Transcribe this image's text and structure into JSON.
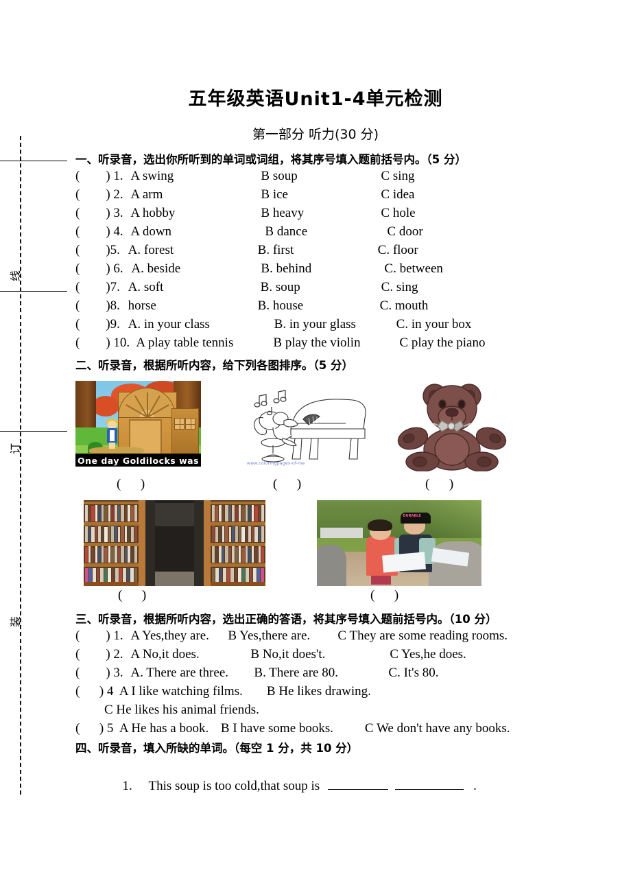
{
  "document": {
    "title": "五年级英语Unit1-4单元检测",
    "part_title": "第一部分    听力(30 分)"
  },
  "binding_margin": {
    "chars": [
      "线",
      "订",
      "装"
    ]
  },
  "sections": [
    {
      "id": "section-1",
      "heading": "一、听录音，选出你所听到的单词或词组，将其序号填入题前括号内。（5 分）",
      "questions": [
        {
          "paren": "(        ) ",
          "num": "1.",
          "a": "A swing",
          "b": "B soup",
          "c": "C sing"
        },
        {
          "paren": "(        ) ",
          "num": "2.",
          "a": "A arm",
          "b": "B ice",
          "c": "C idea"
        },
        {
          "paren": "(        ) ",
          "num": "3.",
          "a": "A hobby",
          "b": "B heavy",
          "c": "C hole"
        },
        {
          "paren": "(        ) ",
          "num": "4.",
          "a": "A down",
          "b": "B dance",
          "c": "C door"
        },
        {
          "paren": "(        )",
          "num": "5.",
          "a": "A. forest",
          "b": "B. first",
          "c": "C. floor"
        },
        {
          "paren": "(        ) ",
          "num": "6.",
          "a": "A. beside",
          "b": "B. behind",
          "c": "C. between"
        },
        {
          "paren": "(        )",
          "num": "7.",
          "a": "A. soft",
          "b": "B. soup",
          "c": "C. sing"
        },
        {
          "paren": "(        )",
          "num": "8.",
          "a": "horse",
          "b": "B. house",
          "c": "C. mouth"
        },
        {
          "paren": "(        )",
          "num": "9.",
          "a": "A. in your class",
          "b": "B. in your glass",
          "c": "C. in your box"
        },
        {
          "paren": "(        ) ",
          "num": "10.",
          "a": "A play table tennis",
          "b": "B play the violin",
          "c": "C play the piano"
        }
      ]
    },
    {
      "id": "section-2",
      "heading": "二、听录音，根据所听内容，给下列各图排序。（5 分）",
      "images_row1": [
        {
          "name": "goldilocks-cartoon",
          "caption": "One  day  Goldilocks  was",
          "answer_box": "(      )"
        },
        {
          "name": "mouse-piano-lineart",
          "watermark": "www.coloringpages-of-me",
          "answer_box": "(      )"
        },
        {
          "name": "teddy-bear",
          "answer_box": "(      )"
        }
      ],
      "images_row2": [
        {
          "name": "library-bookshelves",
          "answer_box": "(      )"
        },
        {
          "name": "children-drawing-outdoors",
          "cap_text": "DURABLE",
          "answer_box": "(      )"
        }
      ]
    },
    {
      "id": "section-3",
      "heading": "三、听录音，根据所听内容，选出正确的答语，将其序号填入题前括号内。（10 分）",
      "questions": [
        {
          "paren": "(        ) ",
          "num": "1.",
          "a": "A Yes,they are.",
          "b": "B Yes,there are.",
          "c": "C They are some reading rooms."
        },
        {
          "paren": "(        ) ",
          "num": "2.",
          "a": "A No,it does.",
          "b": "B No,it does't.",
          "c": "C Yes,he does."
        },
        {
          "paren": "(        ) ",
          "num": "3.",
          "a": "A. There are three.",
          "b": "B. There are 80.",
          "c": "C. It's 80."
        },
        {
          "paren": "(      ) ",
          "num": "4",
          "a": "A I like watching films.",
          "b": "B He likes drawing.",
          "c": "C He likes his animal friends."
        },
        {
          "paren": "(      ) ",
          "num": "5",
          "a": "A He has a book.",
          "b": "B I have some books.",
          "c": "C We don't have any books."
        }
      ]
    },
    {
      "id": "section-4",
      "heading": "四、听录音，填入所缺的单词。（每空 1 分，共 10 分）",
      "items": [
        {
          "num": "1.",
          "text_before": "This soup is too cold,that soup is",
          "text_after": "."
        }
      ]
    }
  ]
}
